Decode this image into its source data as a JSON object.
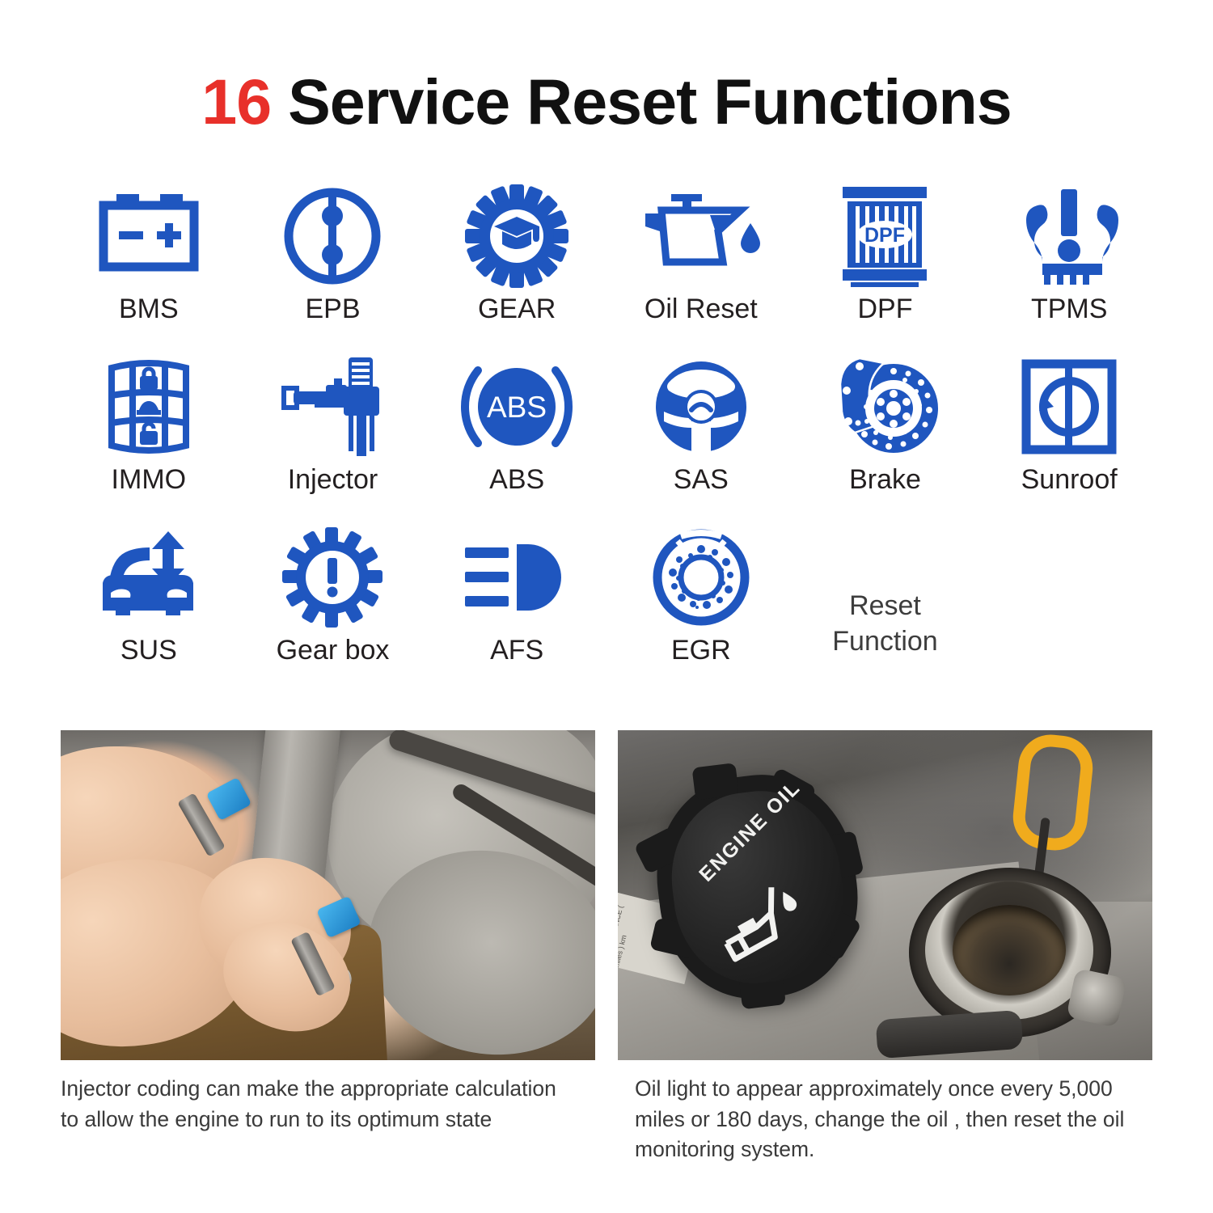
{
  "title": {
    "count": "16",
    "rest": " Service Reset Functions"
  },
  "colors": {
    "brand_blue": "#1f56bf",
    "accent_red": "#e8302a",
    "label_dark": "#231f20",
    "caption_gray": "#3a3a3a"
  },
  "functions": [
    {
      "label": "BMS",
      "icon": "battery-icon"
    },
    {
      "label": "EPB",
      "icon": "electronic-parking-brake-icon"
    },
    {
      "label": "GEAR",
      "icon": "gear-graduation-cap-icon"
    },
    {
      "label": "Oil Reset",
      "icon": "oil-can-icon"
    },
    {
      "label": "DPF",
      "icon": "diesel-particulate-filter-icon",
      "inner_text": "DPF"
    },
    {
      "label": "TPMS",
      "icon": "tire-pressure-warning-icon"
    },
    {
      "label": "IMMO",
      "icon": "key-fob-lock-icon"
    },
    {
      "label": "Injector",
      "icon": "fuel-injector-icon"
    },
    {
      "label": "ABS",
      "icon": "abs-brake-icon",
      "inner_text": "ABS"
    },
    {
      "label": "SAS",
      "icon": "steering-wheel-icon"
    },
    {
      "label": "Brake",
      "icon": "brake-disc-caliper-icon"
    },
    {
      "label": "Sunroof",
      "icon": "sunroof-rotate-icon"
    },
    {
      "label": "SUS",
      "icon": "car-suspension-arrow-icon"
    },
    {
      "label": "Gear box",
      "icon": "gear-exclamation-icon"
    },
    {
      "label": "AFS",
      "icon": "headlight-beam-icon"
    },
    {
      "label": "EGR",
      "icon": "egr-perforated-disc-icon"
    }
  ],
  "reset_function_note": "Reset\nFunction",
  "photos": [
    {
      "alt": "injector-installation-photo",
      "caption": "Injector coding can make the appropriate calculation to allow the engine to run to its optimum state"
    },
    {
      "alt": "engine-oil-cap-photo",
      "cap_text": "ENGINE OIL",
      "sticker_text": "RECOMMENDED PERFORMANCE ( miles ) km",
      "caption": "Oil light to appear approximately once every 5,000 miles or 180 days, change the oil , then reset the oil monitoring system."
    }
  ]
}
